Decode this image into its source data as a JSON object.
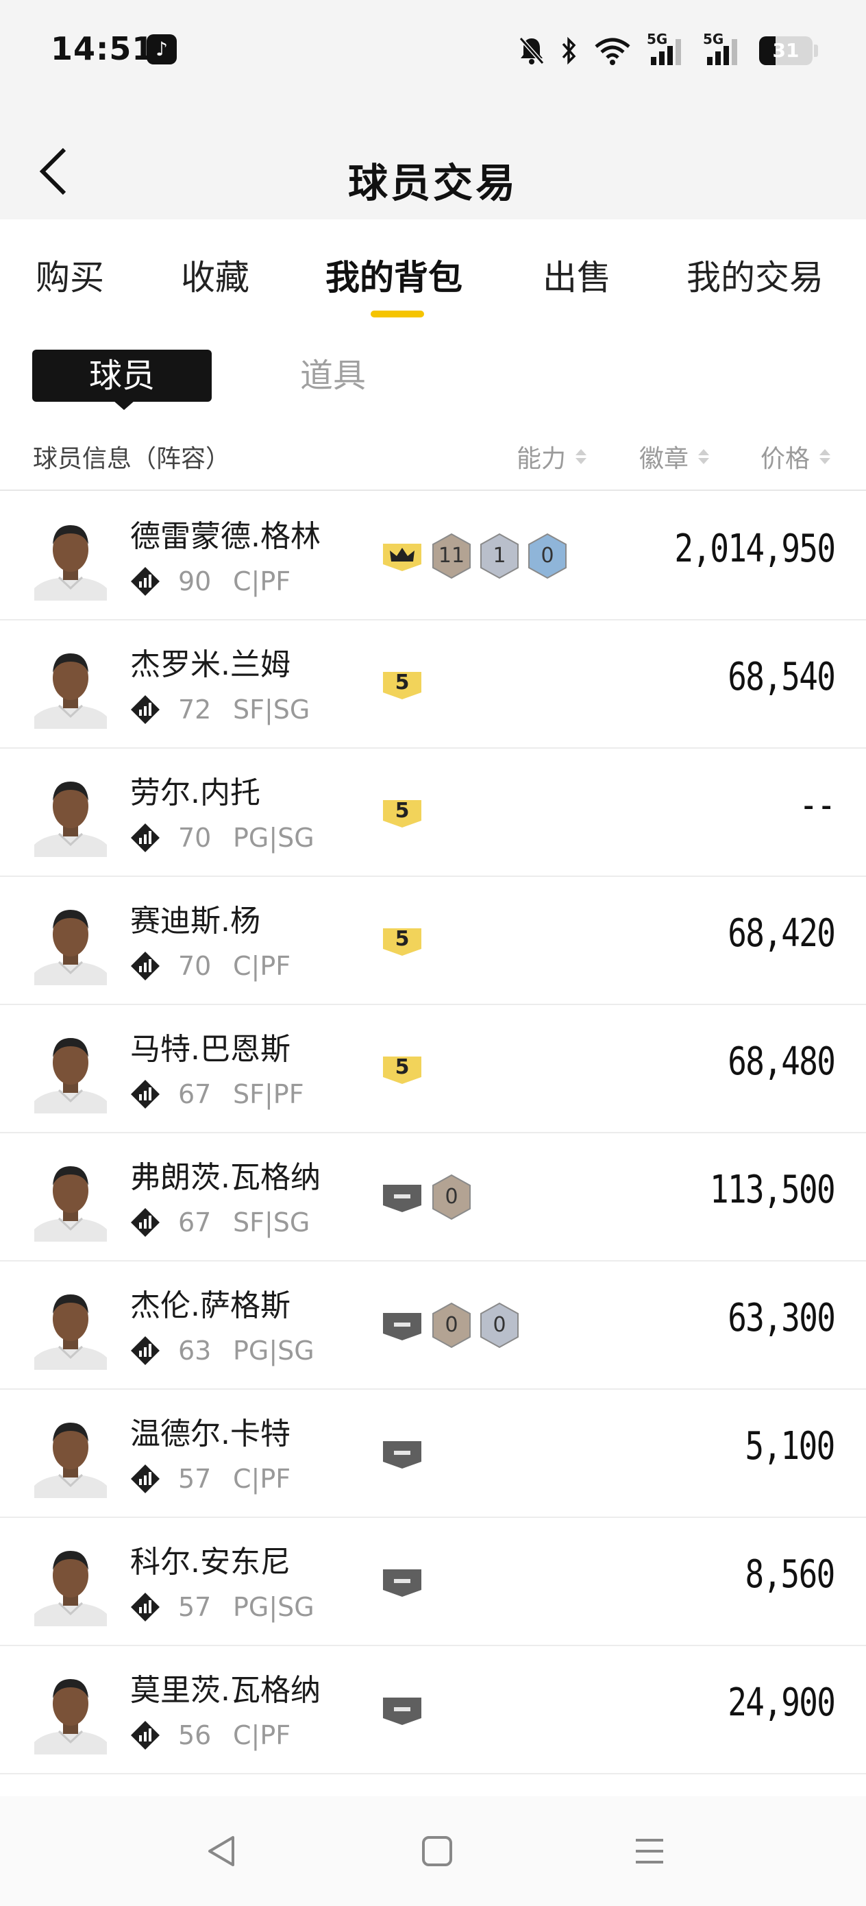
{
  "status_bar": {
    "time": "14:51",
    "app_icon": "tiktok-icon",
    "icons": [
      "mute-bell-icon",
      "bluetooth-icon",
      "wifi-icon",
      "signal-5g-icon",
      "signal-5g-icon"
    ],
    "network_label_1": "5G",
    "network_label_2": "5G",
    "battery": "31",
    "battery_level": 0.31
  },
  "header": {
    "title": "球员交易"
  },
  "tabs": {
    "items": [
      {
        "label": "购买"
      },
      {
        "label": "收藏"
      },
      {
        "label": "我的背包"
      },
      {
        "label": "出售"
      },
      {
        "label": "我的交易"
      }
    ],
    "active": "我的背包",
    "accent": "#f5c400"
  },
  "subtabs": {
    "active": "球员",
    "other": "道具"
  },
  "columns": {
    "info": "球员信息（阵容）",
    "ability": "能力",
    "badge": "徽章",
    "price": "价格"
  },
  "players": [
    {
      "name": "德雷蒙德.格林",
      "rating": "90",
      "position": "C|PF",
      "tier": "crown",
      "badges": [
        {
          "count": "11",
          "level": "bronze"
        },
        {
          "count": "1",
          "level": "silver"
        },
        {
          "count": "0",
          "level": "gold"
        }
      ],
      "price": "2,014,950"
    },
    {
      "name": "杰罗米.兰姆",
      "rating": "72",
      "position": "SF|SG",
      "tier": "5",
      "badges": [],
      "price": "68,540"
    },
    {
      "name": "劳尔.内托",
      "rating": "70",
      "position": "PG|SG",
      "tier": "5",
      "badges": [],
      "price": "--"
    },
    {
      "name": "赛迪斯.杨",
      "rating": "70",
      "position": "C|PF",
      "tier": "5",
      "badges": [],
      "price": "68,420"
    },
    {
      "name": "马特.巴恩斯",
      "rating": "67",
      "position": "SF|PF",
      "tier": "5",
      "badges": [],
      "price": "68,480"
    },
    {
      "name": "弗朗茨.瓦格纳",
      "rating": "67",
      "position": "SF|SG",
      "tier": "gray",
      "badges": [
        {
          "count": "0",
          "level": "bronze"
        }
      ],
      "price": "113,500"
    },
    {
      "name": "杰伦.萨格斯",
      "rating": "63",
      "position": "PG|SG",
      "tier": "gray",
      "badges": [
        {
          "count": "0",
          "level": "bronze"
        },
        {
          "count": "0",
          "level": "silver"
        }
      ],
      "price": "63,300"
    },
    {
      "name": "温德尔.卡特",
      "rating": "57",
      "position": "C|PF",
      "tier": "gray",
      "badges": [],
      "price": "5,100"
    },
    {
      "name": "科尔.安东尼",
      "rating": "57",
      "position": "PG|SG",
      "tier": "gray",
      "badges": [],
      "price": "8,560"
    },
    {
      "name": "莫里茨.瓦格纳",
      "rating": "56",
      "position": "C|PF",
      "tier": "gray",
      "badges": [],
      "price": "24,900"
    }
  ],
  "nav": {
    "icons": [
      "back-triangle-icon",
      "home-square-icon",
      "menu-lines-icon"
    ]
  },
  "colors": {
    "gold_badge": "#f2d35a",
    "gray_tier": "#5f5f5f",
    "bronze_hex": "#b3a393",
    "silver_hex": "#b9bfcb",
    "gold_hex": "#8fb5d9"
  }
}
